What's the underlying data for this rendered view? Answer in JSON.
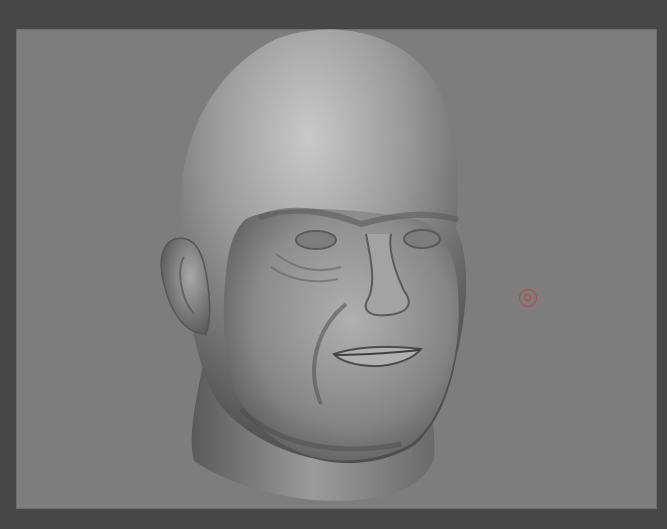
{
  "app": {
    "background_color": "#474747",
    "canvas_color": "#7d7d7d"
  },
  "viewport": {
    "subject": "sculpted-head-model",
    "material_color": "#8e8e8e"
  },
  "cursor": {
    "icon": "brush-cursor-icon",
    "color": "#c8403f"
  }
}
